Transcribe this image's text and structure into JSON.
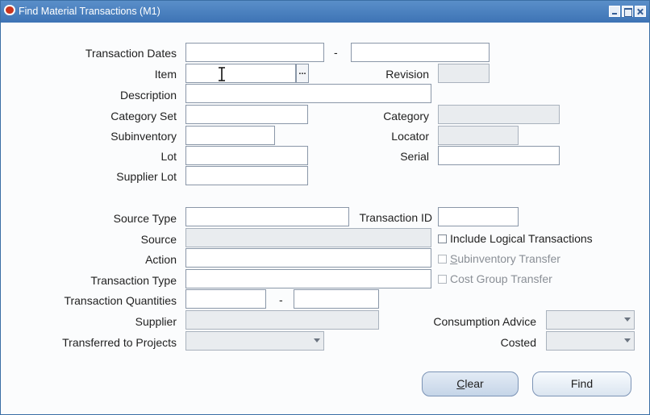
{
  "window": {
    "title": "Find Material Transactions (M1)"
  },
  "labels": {
    "transaction_dates": "Transaction Dates",
    "item": "Item",
    "revision": "Revision",
    "description": "Description",
    "category_set": "Category Set",
    "category": "Category",
    "subinventory": "Subinventory",
    "locator": "Locator",
    "lot": "Lot",
    "serial": "Serial",
    "supplier_lot": "Supplier Lot",
    "source_type": "Source Type",
    "transaction_id": "Transaction ID",
    "source": "Source",
    "action": "Action",
    "transaction_type": "Transaction Type",
    "transaction_quantities": "Transaction Quantities",
    "supplier": "Supplier",
    "transferred_to_projects": "Transferred to Projects",
    "consumption_advice": "Consumption Advice",
    "costed": "Costed"
  },
  "range_separator": "-",
  "lov_button": "...",
  "checkboxes": {
    "include_logical": {
      "label": "Include Logical Transactions",
      "checked": false,
      "enabled": true
    },
    "subinventory_transfer": {
      "prefix": "",
      "mnemonic": "S",
      "rest": "ubinventory Transfer",
      "checked": false,
      "enabled": false
    },
    "cost_group_transfer": {
      "label": "Cost Group Transfer",
      "checked": false,
      "enabled": false
    }
  },
  "buttons": {
    "clear": {
      "mnemonic": "C",
      "rest": "lear"
    },
    "find": {
      "label": "Find"
    }
  },
  "colors": {
    "titlebar": "#4a80c0",
    "readonly_field": "#e9ecef",
    "accent": "#3a6ea5"
  }
}
